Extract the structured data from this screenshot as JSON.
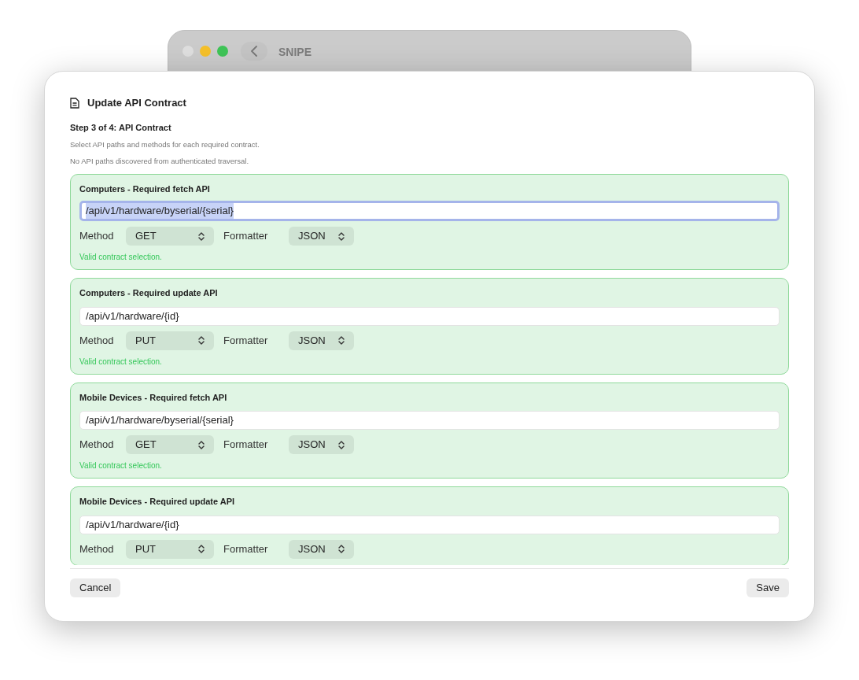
{
  "back_window": {
    "title": "SNIPE"
  },
  "dialog": {
    "title": "Update API Contract",
    "step": "Step 3 of 4: API Contract",
    "notes": [
      "Select API paths and methods for each required contract.",
      "No API paths discovered from authenticated traversal."
    ],
    "contracts": [
      {
        "title": "Computers - Required fetch API",
        "path": "/api/v1/hardware/byserial/{serial}",
        "focused": true,
        "method_label": "Method",
        "method": "GET",
        "formatter_label": "Formatter",
        "formatter": "JSON",
        "status": "Valid contract selection."
      },
      {
        "title": "Computers - Required update API",
        "path": "/api/v1/hardware/{id}",
        "focused": false,
        "method_label": "Method",
        "method": "PUT",
        "formatter_label": "Formatter",
        "formatter": "JSON",
        "status": "Valid contract selection."
      },
      {
        "title": "Mobile Devices - Required fetch API",
        "path": "/api/v1/hardware/byserial/{serial}",
        "focused": false,
        "method_label": "Method",
        "method": "GET",
        "formatter_label": "Formatter",
        "formatter": "JSON",
        "status": "Valid contract selection."
      },
      {
        "title": "Mobile Devices - Required update API",
        "path": "/api/v1/hardware/{id}",
        "focused": false,
        "method_label": "Method",
        "method": "PUT",
        "formatter_label": "Formatter",
        "formatter": "JSON"
      }
    ],
    "buttons": {
      "cancel": "Cancel",
      "save": "Save"
    }
  }
}
